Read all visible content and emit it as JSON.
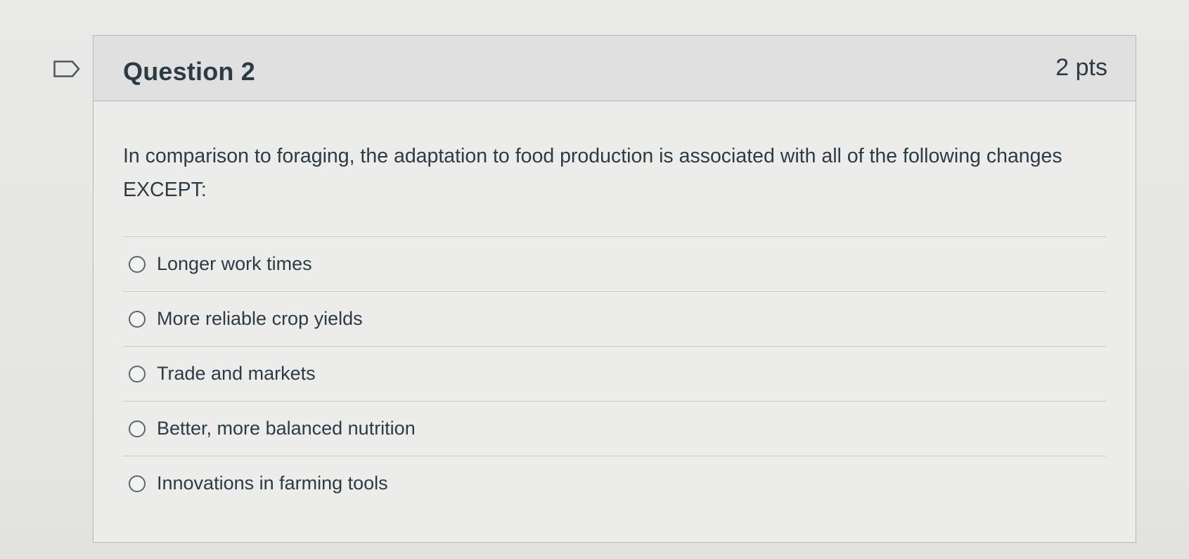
{
  "question": {
    "title": "Question 2",
    "points": "2 pts",
    "text": "In comparison to foraging, the adaptation to food production is associated with all of the following changes EXCEPT:",
    "answers": [
      {
        "label": "Longer work times",
        "selected": false
      },
      {
        "label": "More reliable crop yields",
        "selected": false
      },
      {
        "label": "Trade and markets",
        "selected": false
      },
      {
        "label": "Better, more balanced nutrition",
        "selected": false
      },
      {
        "label": "Innovations in farming tools",
        "selected": false
      }
    ]
  },
  "icons": {
    "flag": "flag-bookmark-icon",
    "radio": "radio-unchecked-icon"
  },
  "colors": {
    "text": "#2d3b45",
    "header_bg": "#dfe0df",
    "border": "#b5b7b8"
  }
}
